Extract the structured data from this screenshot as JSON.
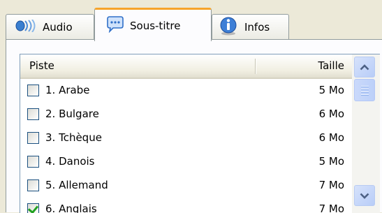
{
  "tabs": [
    {
      "label": "Audio",
      "icon": "audio-waves-icon",
      "active": false
    },
    {
      "label": "Sous-titre",
      "icon": "speech-bubble-icon",
      "active": true
    },
    {
      "label": "Infos",
      "icon": "info-icon",
      "active": false
    }
  ],
  "list": {
    "columns": {
      "name": "Piste",
      "size": "Taille"
    },
    "rows": [
      {
        "name": "1. Arabe",
        "size": "5 Mo",
        "checked": false
      },
      {
        "name": "2. Bulgare",
        "size": "6 Mo",
        "checked": false
      },
      {
        "name": "3. Tchèque",
        "size": "6 Mo",
        "checked": false
      },
      {
        "name": "4. Danois",
        "size": "5 Mo",
        "checked": false
      },
      {
        "name": "5. Allemand",
        "size": "7 Mo",
        "checked": false
      },
      {
        "name": "6. Anglais",
        "size": "7 Mo",
        "checked": true
      }
    ]
  },
  "colors": {
    "accent": "#f7a42b",
    "scroll": "#c1d3fb",
    "check": "#21a121"
  }
}
